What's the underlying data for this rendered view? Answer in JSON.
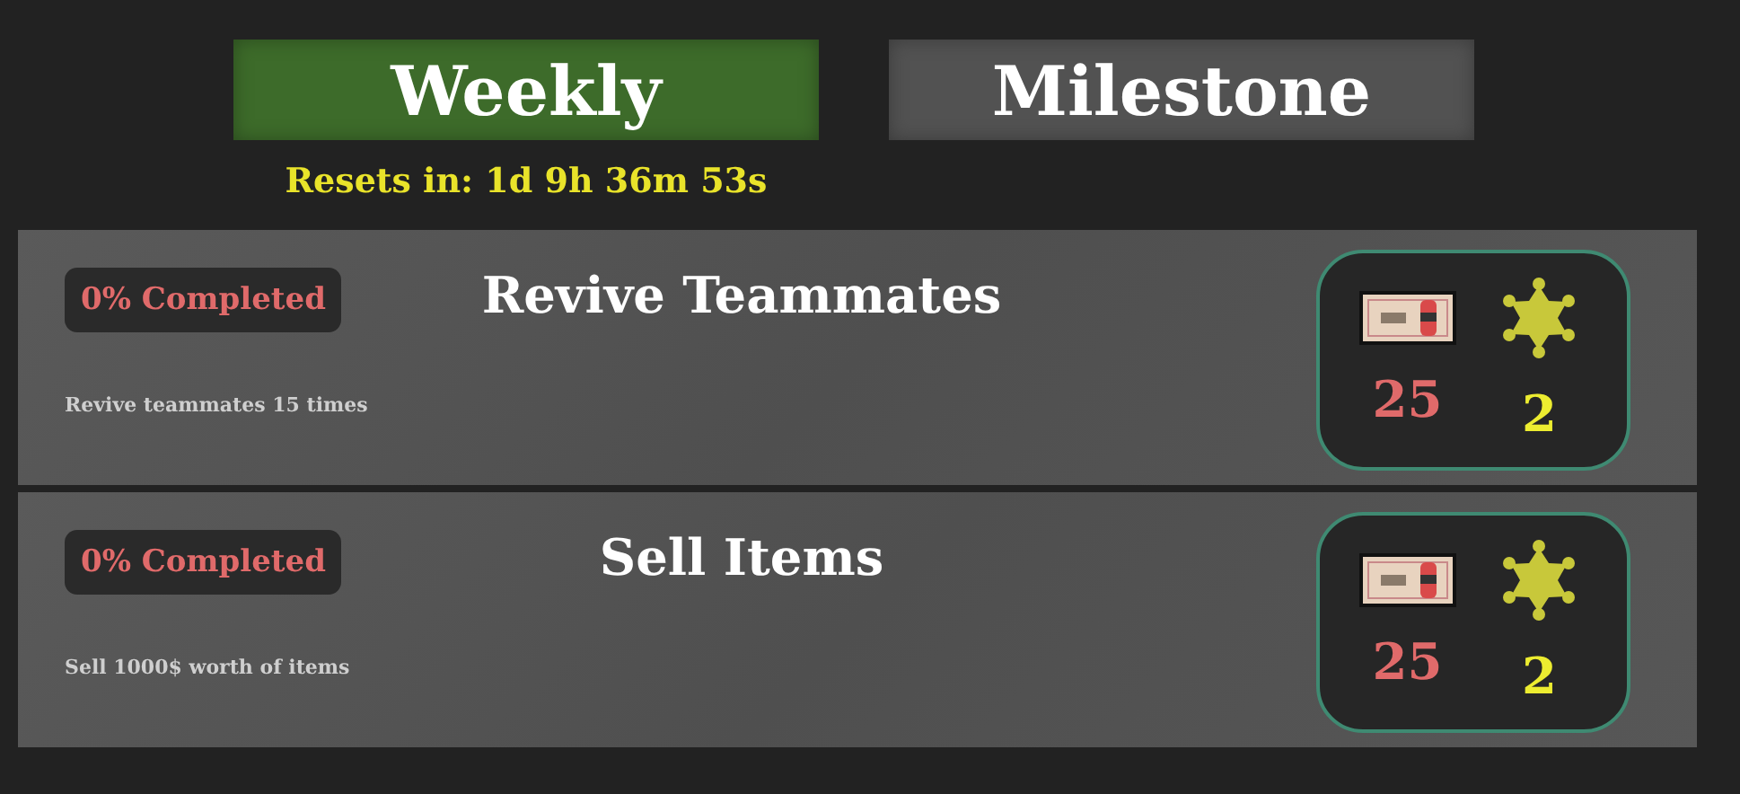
{
  "tabs": [
    {
      "label": "Weekly",
      "selected": true
    },
    {
      "label": "Milestone",
      "selected": false
    }
  ],
  "reset_timer": "Resets in: 1d 9h 36m 53s",
  "challenges": [
    {
      "progress": "0% Completed",
      "title": "Revive Teammates",
      "description": "Revive teammates 15 times",
      "rewards": [
        {
          "kind": "cash",
          "amount": "25"
        },
        {
          "kind": "star",
          "amount": "2"
        }
      ]
    },
    {
      "progress": "0% Completed",
      "title": "Sell Items",
      "description": "Sell 1000$ worth of items",
      "rewards": [
        {
          "kind": "cash",
          "amount": "25"
        },
        {
          "kind": "star",
          "amount": "2"
        }
      ]
    }
  ]
}
